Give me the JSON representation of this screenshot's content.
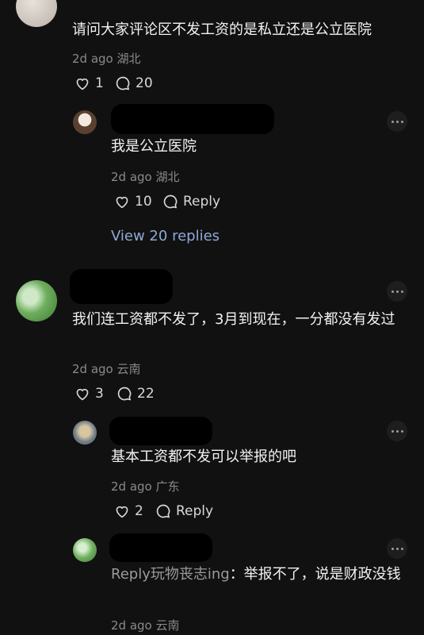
{
  "comments": [
    {
      "text": "请问大家评论区不发工资的是私立还是公立医院",
      "time": "2d ago",
      "location": "湖北",
      "likes": "1",
      "replies_count": "20",
      "replies": [
        {
          "text": "我是公立医院",
          "time": "2d ago",
          "location": "湖北",
          "likes": "10",
          "reply_label": "Reply"
        }
      ],
      "view_replies_label": "View 20 replies"
    },
    {
      "text": "我们连工资都不发了，3月到现在，一分都没有发过",
      "time": "2d ago",
      "location": "云南",
      "likes": "3",
      "replies_count": "22",
      "replies": [
        {
          "text": "基本工资都不发可以举报的吧",
          "time": "2d ago",
          "location": "广东",
          "likes": "2",
          "reply_label": "Reply"
        },
        {
          "reply_prefix": "Reply玩物丧志ing",
          "text": "：举报不了，说是财政没钱",
          "time": "2d ago",
          "location": "云南"
        }
      ]
    }
  ],
  "colors": {
    "background": "#111111",
    "meta": "#8a8a8a",
    "link": "#8fa9d6"
  }
}
